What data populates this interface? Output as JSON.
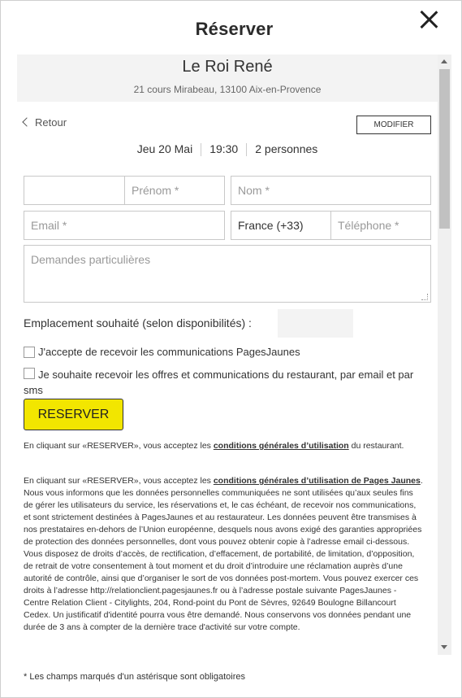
{
  "dialog": {
    "title": "Réserver"
  },
  "restaurant": {
    "name": "Le Roi René",
    "address": "21 cours Mirabeau, 13100 Aix-en-Provence"
  },
  "nav": {
    "back_label": "Retour",
    "modify_label": "MODIFIER"
  },
  "booking": {
    "date": "Jeu 20 Mai",
    "time": "19:30",
    "guests": "2 personnes"
  },
  "form": {
    "civility_value": "",
    "firstname_placeholder": "Prénom *",
    "lastname_placeholder": "Nom *",
    "email_placeholder": "Email *",
    "country_value": "France (+33)",
    "phone_placeholder": "Téléphone *",
    "requests_placeholder": "Demandes particulières",
    "location_label": "Emplacement souhaité (selon disponibilités) :",
    "location_value": "",
    "optin_pagesjaunes": "J'accepte de recevoir les communications PagesJaunes",
    "optin_restaurant": "Je souhaite recevoir les offres et communications du restaurant, par email et par sms",
    "submit_label": "RESERVER"
  },
  "legal": {
    "p1_prefix": "En cliquant sur «RESERVER», vous acceptez les ",
    "p1_link": "conditions générales d’utilisation",
    "p1_suffix": " du restaurant.",
    "p2_prefix": "En cliquant sur «RESERVER», vous acceptez les ",
    "p2_link": "conditions générales d’utilisation de Pages Jaunes",
    "p2_suffix": ". Nous vous informons que les données personnelles communiquées ne sont utilisées qu’aux seules fins de gérer les utilisateurs du service, les réservations et, le cas échéant, de recevoir nos communications, et sont strictement destinées à PagesJaunes et au restaurateur. Les données peuvent être transmises à nos prestataires en-dehors de l’Union européenne, desquels nous avons exigé des garanties appropriées de protection des données personnelles, dont vous pouvez obtenir copie à l’adresse email ci-dessous. Vous disposez de droits d’accès, de rectification, d’effacement, de portabilité, de limitation, d’opposition, de retrait de votre consentement à tout moment et du droit d’introduire une réclamation auprès d’une autorité de contrôle, ainsi que d’organiser le sort de vos données post-mortem. Vous pouvez exercer ces droits à l’adresse http://relationclient.pagesjaunes.fr ou à l’adresse postale suivante PagesJaunes - Centre Relation Client - Citylights, 204, Rond-point du Pont de Sèvres, 92649 Boulogne Billancourt Cedex. Un justificatif d'identité pourra vous être demandé. Nous conservons vos données pendant une durée de 3 ans à compter de la dernière trace d'activité sur votre compte."
  },
  "footer": {
    "required_note": "* Les champs marqués d'un astérisque sont obligatoires"
  }
}
